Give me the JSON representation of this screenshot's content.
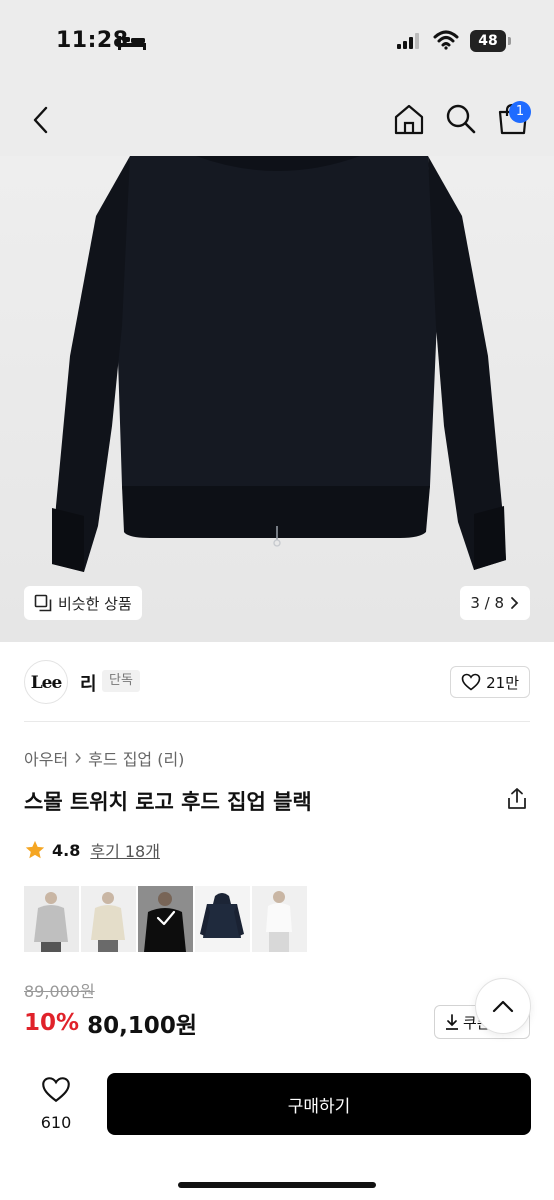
{
  "status_bar": {
    "time": "11:28",
    "battery": "48",
    "icons": [
      "bed-icon",
      "signal-icon",
      "wifi-icon",
      "battery-icon"
    ]
  },
  "nav": {
    "icons": [
      "back-icon",
      "home-icon",
      "search-icon",
      "cart-icon"
    ],
    "cart_badge": "1"
  },
  "gallery": {
    "similar_label": "비슷한 상품",
    "counter": "3 / 8"
  },
  "brand": {
    "logo_text": "Lee",
    "name": "리",
    "exclusive_badge": "단독",
    "likes": "21만"
  },
  "product": {
    "breadcrumb": [
      "아우터",
      "후드 집업 (리)"
    ],
    "title": "스몰 트위치 로고 후드 집업 블랙",
    "rating": "4.8",
    "reviews": "후기 18개",
    "original_price": "89,000원",
    "discount": "10%",
    "price": "80,100원",
    "coupon_label": "쿠폰"
  },
  "bottom_bar": {
    "wish_count": "610",
    "buy_label": "구매하기"
  },
  "colors": {
    "accent_blue": "#1e6bff",
    "discount_red": "#e0222a",
    "star": "#f5a623",
    "buy_button": "#000000"
  }
}
